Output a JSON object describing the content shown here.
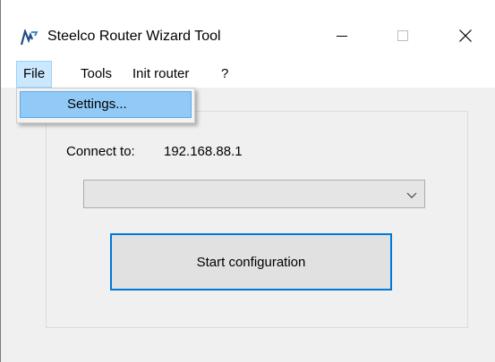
{
  "window": {
    "title": "Steelco Router Wizard Tool",
    "controls": {
      "minimize": "minimize-icon",
      "maximize": "maximize-icon",
      "close": "close-icon"
    }
  },
  "menubar": {
    "items": [
      {
        "label": "File",
        "open": true
      },
      {
        "label": "Tools"
      },
      {
        "label": "Init router"
      },
      {
        "label": "?"
      }
    ]
  },
  "file_menu": {
    "items": [
      {
        "label": "Settings..."
      }
    ]
  },
  "main": {
    "connect_label": "Connect to:",
    "connect_value": "192.168.88.1",
    "combo_value": "",
    "start_button": "Start configuration"
  },
  "colors": {
    "menu_highlight": "#91c9f7",
    "menu_open": "#cce8ff",
    "focus_border": "#0078d7",
    "window_bg": "#f0f0f0"
  }
}
